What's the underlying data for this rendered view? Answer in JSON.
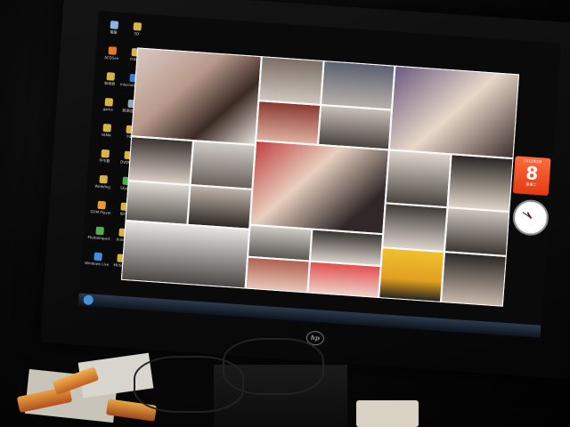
{
  "scene": {
    "description_colors": {
      "bezel": "#0b0b0b",
      "collage_bg": "#f3f3f3",
      "calendar": "#e84a1e"
    }
  },
  "desktop_icons": [
    {
      "label": "電腦",
      "color": "#8fb3e0"
    },
    {
      "label": "SD",
      "color": "#d8b34a"
    },
    {
      "label": "ACDSee",
      "color": "#e07a2c"
    },
    {
      "label": "TUNE",
      "color": "#d8b34a"
    },
    {
      "label": "新增資",
      "color": "#d8b34a"
    },
    {
      "label": "Internet Explorer",
      "color": "#3d7fd8"
    },
    {
      "label": "game",
      "color": "#d8b34a"
    },
    {
      "label": "資源回收筒",
      "color": "#9aa7b5"
    },
    {
      "label": "YAMA",
      "color": "#d8b34a"
    },
    {
      "label": "下載",
      "color": "#d8b34a"
    },
    {
      "label": "手中寶",
      "color": "#d8b34a"
    },
    {
      "label": "DVDMPI",
      "color": "#d8b34a"
    },
    {
      "label": "Wedding",
      "color": "#d8b34a"
    },
    {
      "label": "Skype",
      "color": "#4cb04c"
    },
    {
      "label": "GOM Player",
      "color": "#e0a030"
    },
    {
      "label": "IEEE",
      "color": "#d8b34a"
    },
    {
      "label": "PhotoImpact",
      "color": "#4cb04c"
    },
    {
      "label": "book1",
      "color": "#d8b34a"
    },
    {
      "label": "Windows Live Messenger",
      "color": "#4a8ad8"
    },
    {
      "label": "MUSLIB",
      "color": "#d8b34a"
    }
  ],
  "gadgets": {
    "calendar": {
      "month": "2011年2月",
      "day": "8",
      "weekday": "星期二"
    },
    "clock": {
      "hour": 10,
      "minute": 50
    }
  },
  "monitor": {
    "brand": "hp"
  }
}
